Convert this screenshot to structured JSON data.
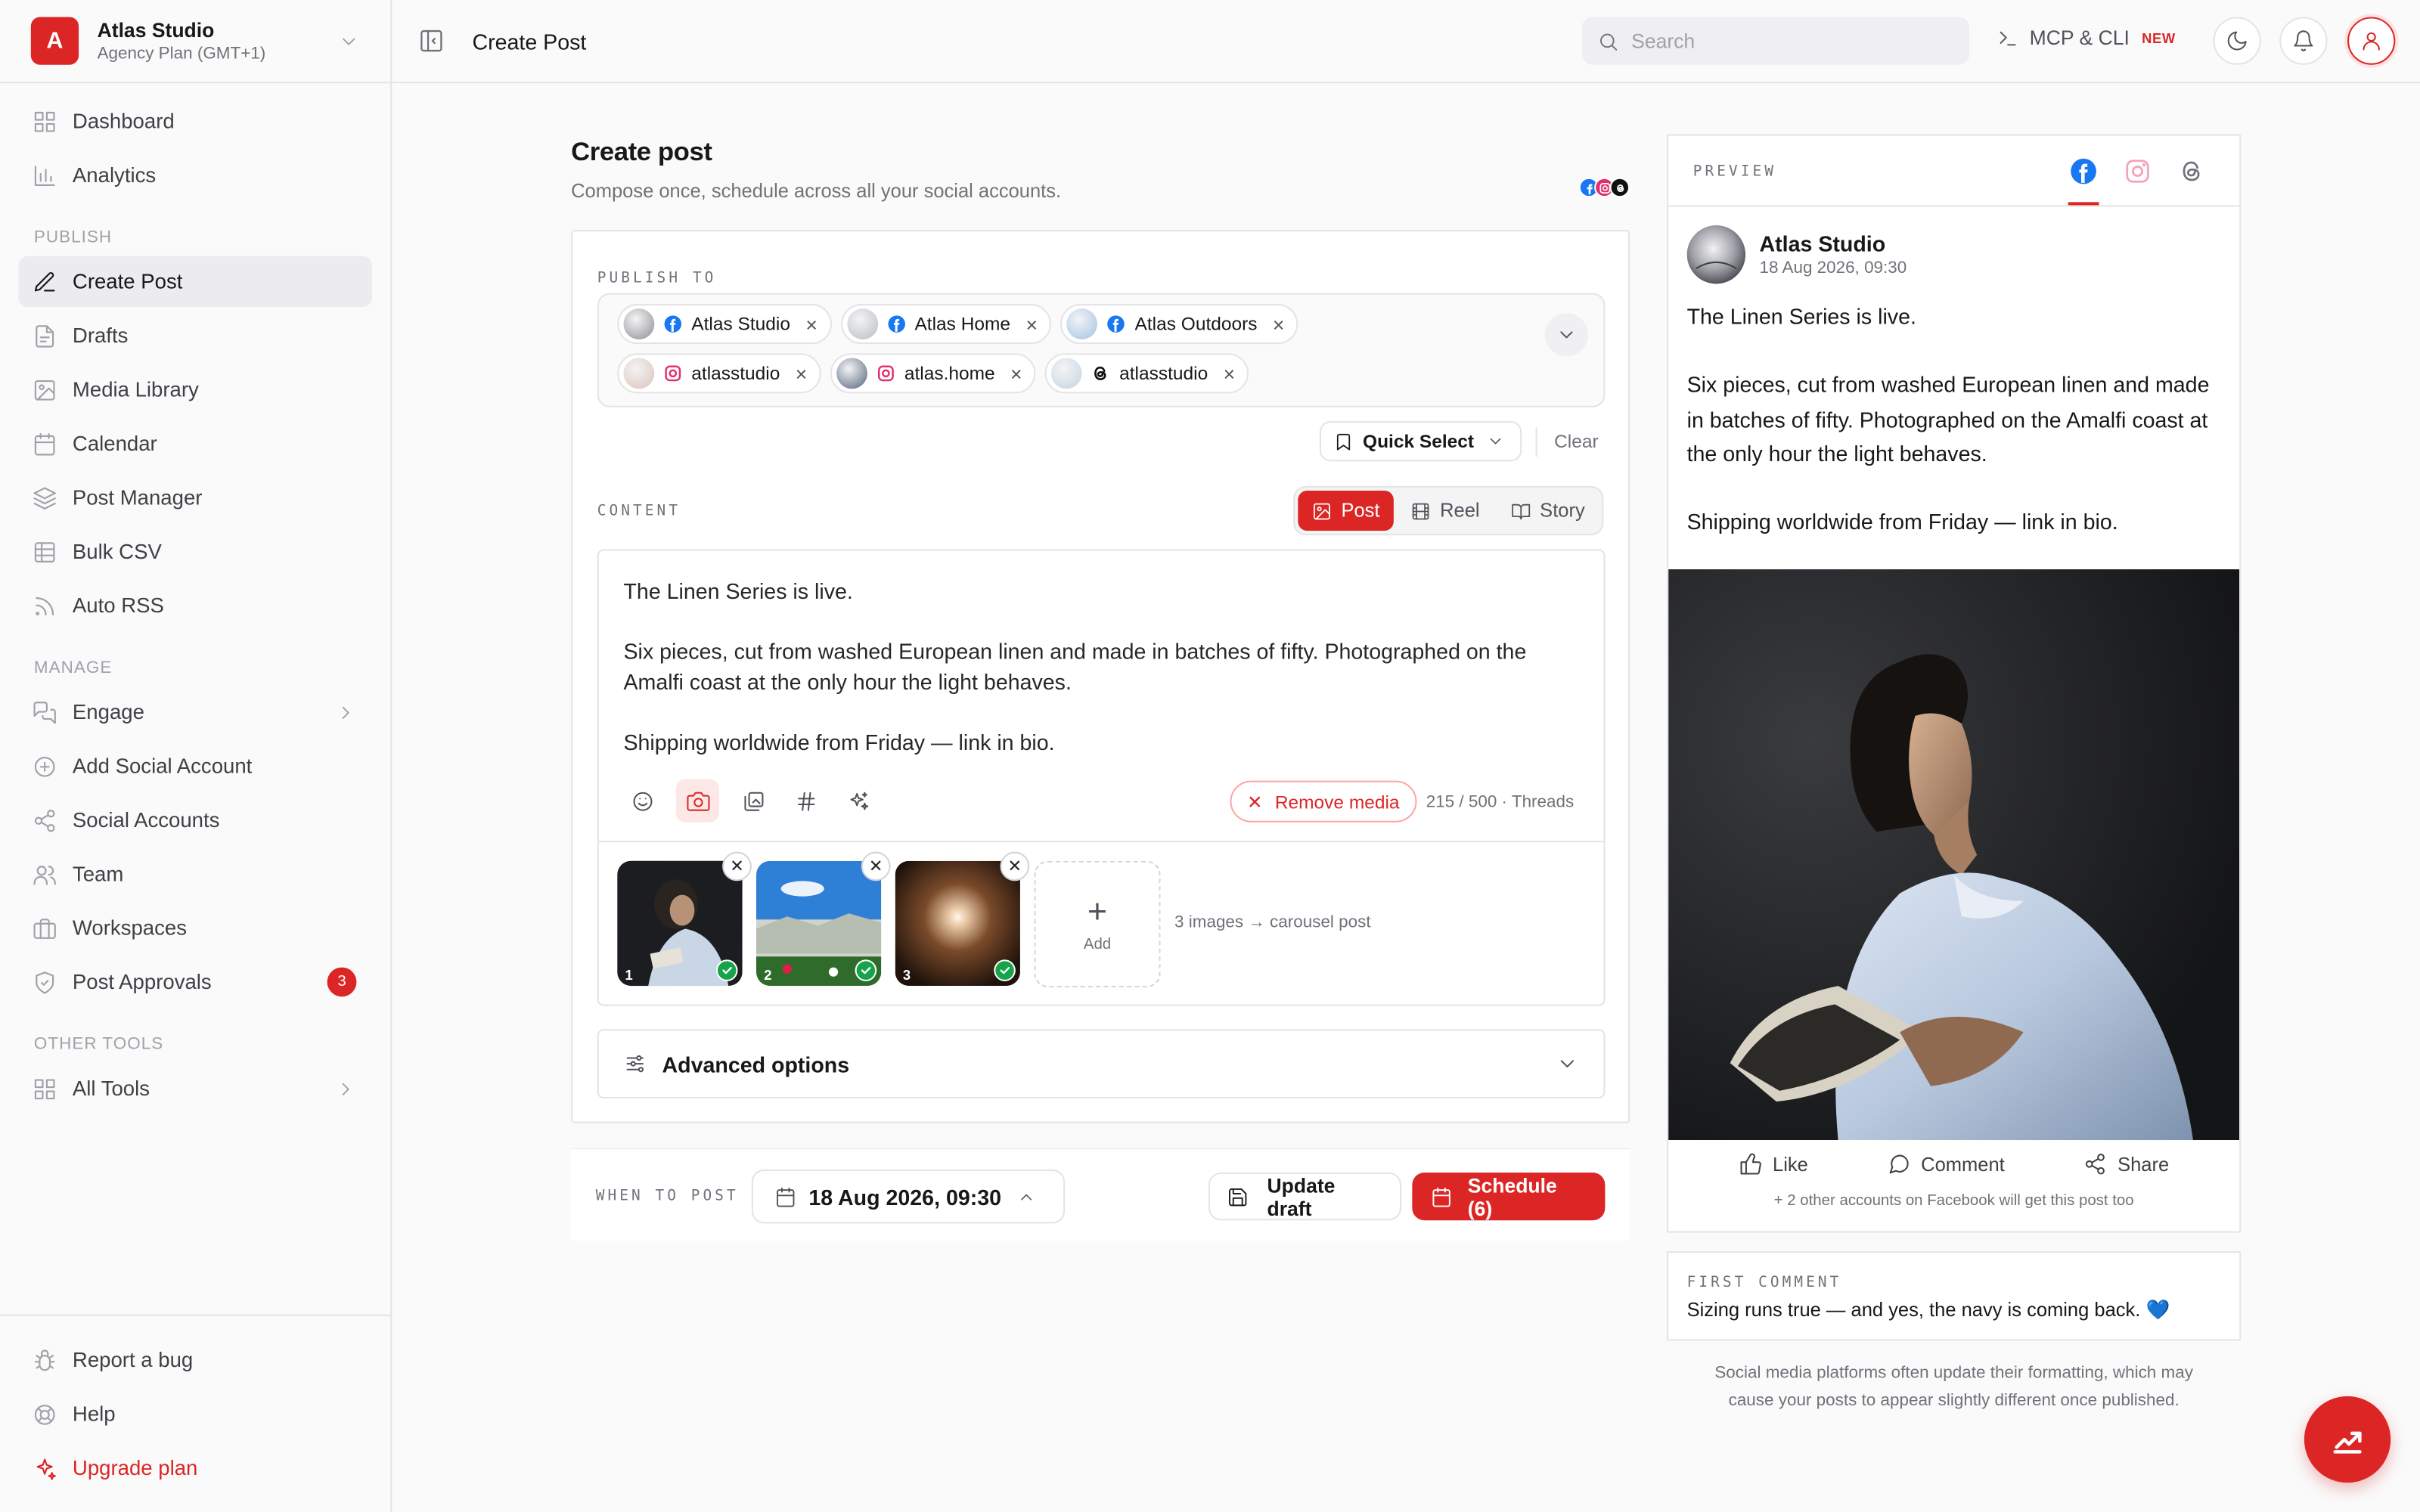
{
  "workspace": {
    "initial": "A",
    "name": "Atlas Studio",
    "plan": "Agency Plan (GMT+1)"
  },
  "nav": {
    "dashboard": "Dashboard",
    "analytics": "Analytics",
    "section_publish": "PUBLISH",
    "create_post": "Create Post",
    "drafts": "Drafts",
    "media_library": "Media Library",
    "calendar": "Calendar",
    "post_manager": "Post Manager",
    "bulk_csv": "Bulk CSV",
    "auto_rss": "Auto RSS",
    "section_manage": "MANAGE",
    "engage": "Engage",
    "add_social_account": "Add Social Account",
    "social_accounts": "Social Accounts",
    "team": "Team",
    "workspaces": "Workspaces",
    "post_approvals": "Post Approvals",
    "post_approvals_badge": "3",
    "section_other": "OTHER TOOLS",
    "all_tools": "All Tools",
    "report_bug": "Report a bug",
    "help": "Help",
    "upgrade": "Upgrade plan"
  },
  "topbar": {
    "title": "Create Post",
    "search_placeholder": "Search",
    "mcp_label": "MCP & CLI",
    "mcp_badge": "NEW"
  },
  "composer": {
    "title": "Create post",
    "subtitle": "Compose once, schedule across all your social accounts.",
    "publish_to_label": "PUBLISH TO",
    "accounts_row1": [
      {
        "name": "Atlas Studio",
        "network": "facebook"
      },
      {
        "name": "Atlas Home",
        "network": "facebook"
      },
      {
        "name": "Atlas Outdoors",
        "network": "facebook"
      }
    ],
    "accounts_row2": [
      {
        "name": "atlasstudio",
        "network": "instagram"
      },
      {
        "name": "atlas.home",
        "network": "instagram"
      },
      {
        "name": "atlasstudio",
        "network": "threads"
      }
    ],
    "chip_remove": "×",
    "quick_select": "Quick Select",
    "clear": "Clear",
    "content_label": "CONTENT",
    "tabs": {
      "post": "Post",
      "reel": "Reel",
      "story": "Story"
    },
    "body": [
      "The Linen Series is live.",
      "Six pieces, cut from washed European linen and made in batches of fifty. Photographed on the Amalfi coast at the only hour the light behaves.",
      "Shipping worldwide from Friday — link in bio."
    ],
    "remove_media": "Remove media",
    "char_count": "215 / 500 · Threads",
    "thumb_numbers": [
      "1",
      "2",
      "3"
    ],
    "add_label": "Add",
    "carousel_note": "3 images → carousel post",
    "advanced_options": "Advanced options"
  },
  "schedule": {
    "when_label": "WHEN TO POST",
    "datetime": "18 Aug 2026, 09:30",
    "update_draft": "Update draft",
    "schedule_button": "Schedule (6)"
  },
  "preview": {
    "label": "PREVIEW",
    "active_tab": "facebook",
    "account_name": "Atlas Studio",
    "timestamp": "18 Aug 2026, 09:30",
    "body": [
      "The Linen Series is live.",
      "Six pieces, cut from washed European linen and made in batches of fifty. Photographed on the Amalfi coast at the only hour the light behaves.",
      "Shipping worldwide from Friday — link in bio."
    ],
    "like": "Like",
    "comment": "Comment",
    "share": "Share",
    "note": "+ 2 other accounts on Facebook will get this post too"
  },
  "first_comment": {
    "label": "FIRST COMMENT",
    "text": "Sizing runs true — and yes, the navy is coming back. 💙"
  },
  "disclaimer": "Social media platforms often update their formatting, which may cause your posts to appear slightly different once published.",
  "colors": {
    "accent": "#dc2626",
    "facebook": "#1877f2",
    "instagram": "#e1306c",
    "threads": "#000000"
  }
}
